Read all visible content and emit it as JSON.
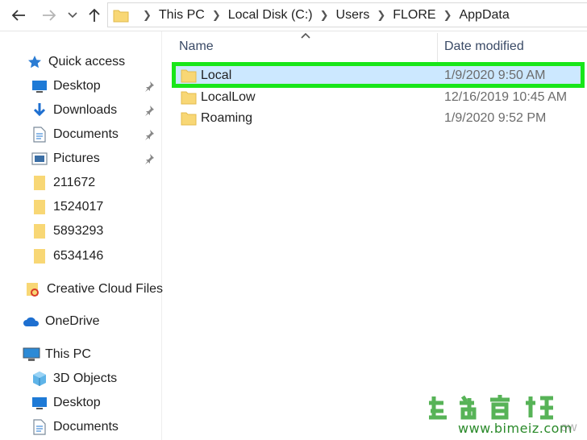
{
  "toolbar": {
    "back_icon": "arrow-left-icon",
    "forward_icon": "arrow-right-icon",
    "recent_icon": "chevron-down-icon",
    "up_icon": "arrow-up-icon"
  },
  "address": {
    "crumbs": [
      "This PC",
      "Local Disk (C:)",
      "Users",
      "FLORE",
      "AppData"
    ]
  },
  "sidebar": {
    "items": [
      {
        "label": "Quick access",
        "icon": "star-icon"
      },
      {
        "label": "Desktop",
        "icon": "desktop-icon",
        "pinned": true
      },
      {
        "label": "Downloads",
        "icon": "download-icon",
        "pinned": true
      },
      {
        "label": "Documents",
        "icon": "document-icon",
        "pinned": true
      },
      {
        "label": "Pictures",
        "icon": "picture-icon",
        "pinned": true
      },
      {
        "label": "211672",
        "icon": "folder-icon"
      },
      {
        "label": "1524017",
        "icon": "folder-icon"
      },
      {
        "label": "5893293",
        "icon": "folder-icon"
      },
      {
        "label": "6534146",
        "icon": "folder-icon"
      },
      {
        "label": "Creative Cloud Files",
        "icon": "creative-cloud-icon"
      },
      {
        "label": "OneDrive",
        "icon": "cloud-icon"
      },
      {
        "label": "This PC",
        "icon": "computer-icon"
      },
      {
        "label": "3D Objects",
        "icon": "cube-icon"
      },
      {
        "label": "Desktop",
        "icon": "desktop-icon"
      },
      {
        "label": "Documents",
        "icon": "document-icon"
      }
    ]
  },
  "columns": {
    "name": "Name",
    "date_modified": "Date modified"
  },
  "files": [
    {
      "name": "Local",
      "date": "1/9/2020 9:50 AM",
      "selected": true
    },
    {
      "name": "LocalLow",
      "date": "12/16/2019 10:45 AM",
      "selected": false
    },
    {
      "name": "Roaming",
      "date": "1/9/2020 9:52 PM",
      "selected": false
    }
  ],
  "watermark": {
    "url": "www.bimeiz.com",
    "tail": "ow"
  },
  "colors": {
    "highlight": "#19e619",
    "selection": "#cce8ff",
    "folder": "#f8d775",
    "accent": "#1e6fd0"
  }
}
